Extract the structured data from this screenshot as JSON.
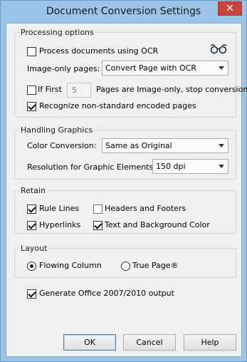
{
  "window": {
    "title": "Document Conversion Settings",
    "close_glyph": "✕"
  },
  "processing": {
    "legend": "Processing options",
    "ocr_label": "Process documents using OCR",
    "ocr_checked": false,
    "glasses_icon": "glasses-icon",
    "image_only_label": "Image-only pages:",
    "image_only_value": "Convert Page with OCR",
    "if_first_label": "If First",
    "if_first_checked": false,
    "if_first_value": "5",
    "if_first_suffix": "Pages are Image-only, stop conversion",
    "recognize_label": "Recognize non-standard encoded pages",
    "recognize_checked": true
  },
  "graphics": {
    "legend": "Handling Graphics",
    "color_label": "Color Conversion:",
    "color_value": "Same as Original",
    "resolution_label": "Resolution for Graphic Elements:",
    "resolution_value": "150 dpi"
  },
  "retain": {
    "legend": "Retain",
    "rule_lines": "Rule Lines",
    "rule_lines_checked": true,
    "headers_footers": "Headers and Footers",
    "headers_footers_checked": false,
    "hyperlinks": "Hyperlinks",
    "hyperlinks_checked": true,
    "text_bg": "Text and Background Color",
    "text_bg_checked": true
  },
  "layout": {
    "legend": "Layout",
    "flowing": "Flowing Column",
    "flowing_selected": true,
    "true_page": "True Page®",
    "true_page_selected": false
  },
  "office": {
    "label": "Generate Office 2007/2010 output",
    "checked": true
  },
  "buttons": {
    "ok": "OK",
    "cancel": "Cancel",
    "help": "Help"
  }
}
